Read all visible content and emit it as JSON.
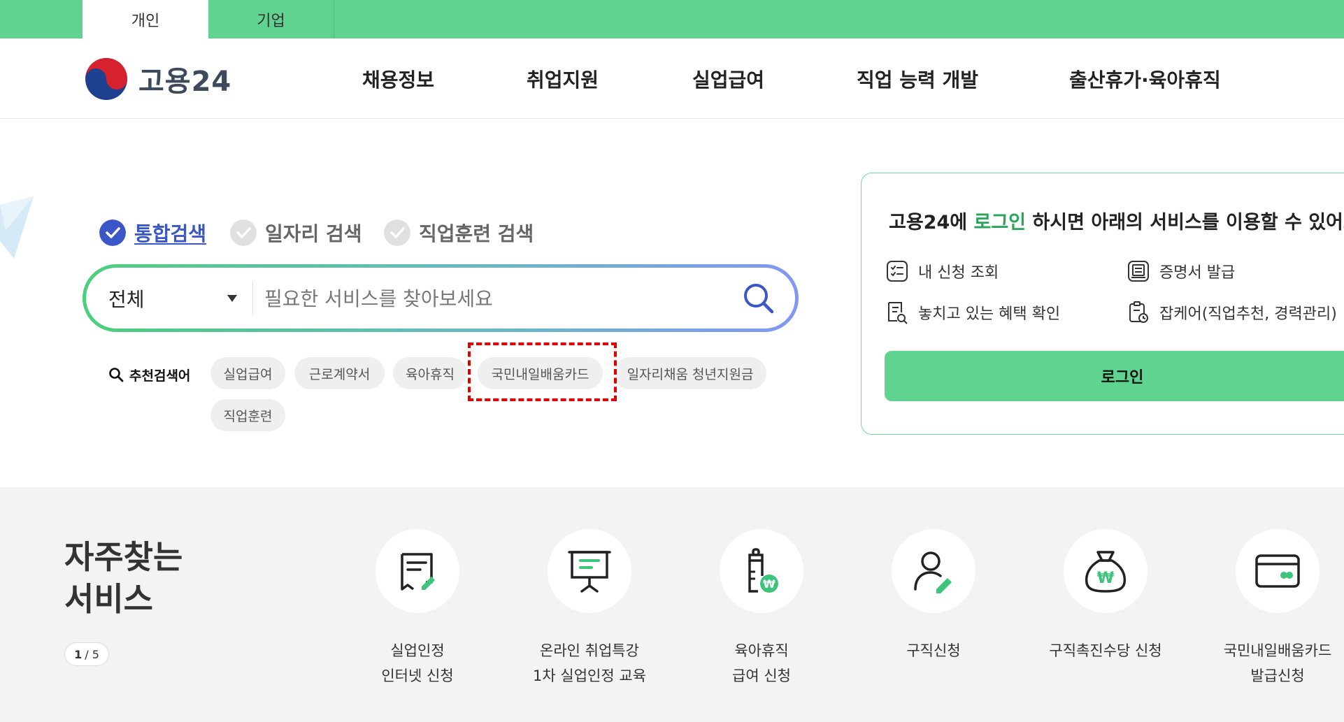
{
  "topbar": {
    "tabs": [
      "개인",
      "기업"
    ]
  },
  "header": {
    "logo_text": "고용24",
    "nav": [
      "채용정보",
      "취업지원",
      "실업급여",
      "직업 능력 개발",
      "출산휴가·육아휴직"
    ]
  },
  "search": {
    "tabs": [
      "통합검색",
      "일자리 검색",
      "직업훈련 검색"
    ],
    "category": "전체",
    "placeholder": "필요한 서비스를 찾아보세요",
    "recommend_label": "추천검색어",
    "keywords": [
      "실업급여",
      "근로계약서",
      "육아휴직",
      "국민내일배움카드",
      "일자리채움 청년지원금",
      "직업훈련"
    ]
  },
  "login_panel": {
    "title_before": "고용24에 ",
    "title_accent": "로그인",
    "title_after": " 하시면 아래의 서비스를 이용할 수 있어요",
    "items": [
      "내 신청 조회",
      "증명서 발급",
      "놓치고 있는 혜택 확인",
      "잡케어(직업추천, 경력관리)"
    ],
    "login_button": "로그인"
  },
  "frequent": {
    "title_line1": "자주찾는",
    "title_line2": "서비스",
    "pager_current": "1",
    "pager_total": "/ 5",
    "services": [
      {
        "name": "실업인정\n인터넷 신청",
        "icon": "document-pen-icon"
      },
      {
        "name": "온라인 취업특강\n1차 실업인정 교육",
        "icon": "presentation-board-icon"
      },
      {
        "name": "육아휴직\n급여 신청",
        "icon": "baby-bottle-won-icon"
      },
      {
        "name": "구직신청",
        "icon": "person-pen-icon"
      },
      {
        "name": "구직촉진수당 신청",
        "icon": "money-bag-won-icon"
      },
      {
        "name": "국민내일배움카드\n발급신청",
        "icon": "credit-card-icon"
      }
    ]
  },
  "colors": {
    "brand_green": "#5fd38f",
    "accent_blue": "#3b57c7",
    "highlight_red": "#e00000"
  }
}
